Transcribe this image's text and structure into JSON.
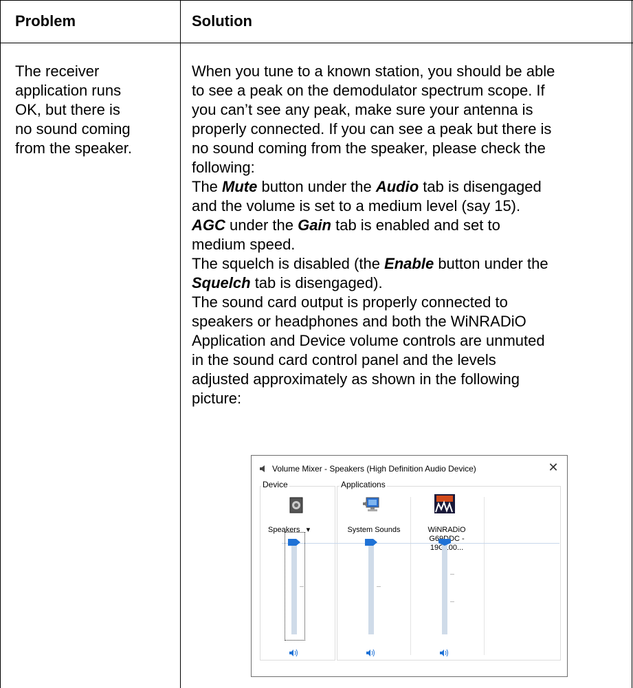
{
  "table": {
    "header": {
      "problem": "Problem",
      "solution": "Solution"
    },
    "row": {
      "problem_lines": [
        "The receiver",
        "application runs",
        "OK, but there is",
        "no sound coming",
        "from the speaker."
      ],
      "solution": {
        "intro_lines": [
          "When you tune to a known station, you should be able",
          "to see a peak on the demodulator spectrum scope. If",
          "you can’t see any peak, make sure your antenna is",
          "properly connected. If you can see a peak but there is",
          "no sound coming from the speaker, please check the",
          "following:"
        ],
        "mute": {
          "a": "The ",
          "b1": "Mute",
          "c": " button under the ",
          "b2": "Audio",
          "d": " tab is disengaged"
        },
        "mute_line2": "and the volume is set to a medium level (say 15).",
        "agc": {
          "b1": "AGC",
          "c": " under the ",
          "b2": "Gain",
          "d": " tab is enabled and set to"
        },
        "agc_line2": "medium speed.",
        "squelch": {
          "a": "The squelch is disabled (the ",
          "b1": "Enable",
          "c": " button under the"
        },
        "squelch2": {
          "b2": "Squelch",
          "d": " tab is disengaged)."
        },
        "sound_lines": [
          "The sound card output is properly connected to",
          "speakers or headphones and both the WiNRADiO",
          "Application and Device volume controls are unmuted",
          "in the sound card control panel and the levels",
          "adjusted approximately as shown in the following",
          "picture:"
        ]
      }
    }
  },
  "volume_mixer": {
    "title": "Volume Mixer - Speakers (High Definition Audio Device)",
    "close_label": "✕",
    "device_group_label": "Device",
    "applications_group_label": "Applications",
    "device": {
      "name": "Speakers",
      "dropdown_glyph": "▾",
      "level": 1.0
    },
    "applications": [
      {
        "name_lines": [
          "System Sounds"
        ],
        "level": 1.0
      },
      {
        "name_lines": [
          "WiNRADiO",
          "G69DDC - 19G100..."
        ],
        "level": 1.0
      }
    ],
    "volume_icon": "speaker-volume-icon"
  }
}
